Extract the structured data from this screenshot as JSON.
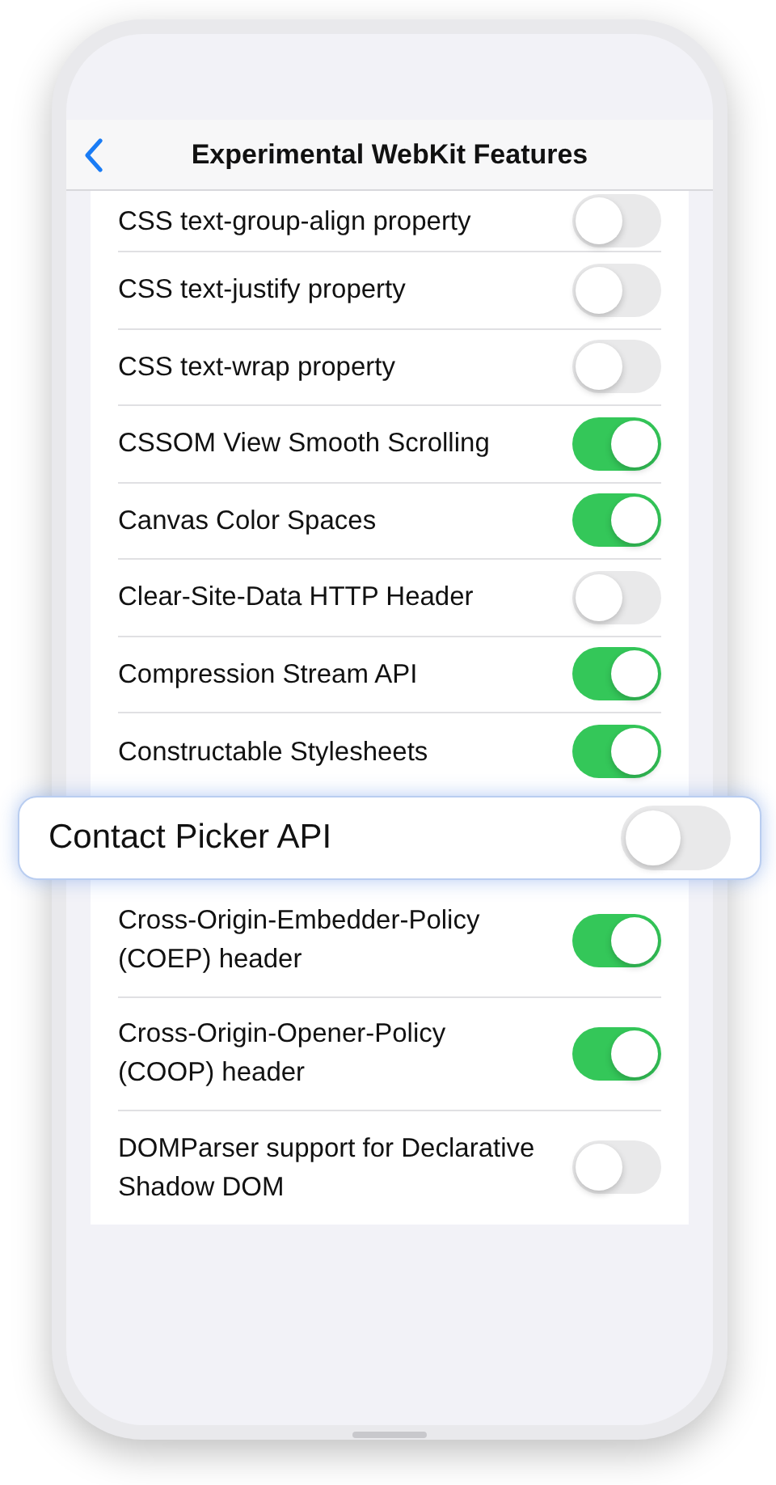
{
  "header": {
    "title": "Experimental WebKit Features"
  },
  "features": [
    {
      "kind": "row",
      "label": "CSS text-group-align property",
      "on": false
    },
    {
      "kind": "row",
      "label": "CSS text-justify property",
      "on": false
    },
    {
      "kind": "row",
      "label": "CSS text-wrap property",
      "on": false
    },
    {
      "kind": "row",
      "label": "CSSOM View Smooth Scrolling",
      "on": true
    },
    {
      "kind": "row",
      "label": "Canvas Color Spaces",
      "on": true
    },
    {
      "kind": "row",
      "label": "Clear-Site-Data HTTP Header",
      "on": false
    },
    {
      "kind": "row",
      "label": "Compression Stream API",
      "on": true
    },
    {
      "kind": "row",
      "label": "Constructable Stylesheets",
      "on": true
    },
    {
      "kind": "callout",
      "label": "Contact Picker API",
      "on": false
    },
    {
      "kind": "row",
      "label": "Cross-Origin-Embedder-Policy (COEP) header",
      "on": true
    },
    {
      "kind": "row",
      "label": "Cross-Origin-Opener-Policy (COOP) header",
      "on": true
    },
    {
      "kind": "row",
      "label": "DOMParser support for Declarative Shadow DOM",
      "on": false
    }
  ]
}
